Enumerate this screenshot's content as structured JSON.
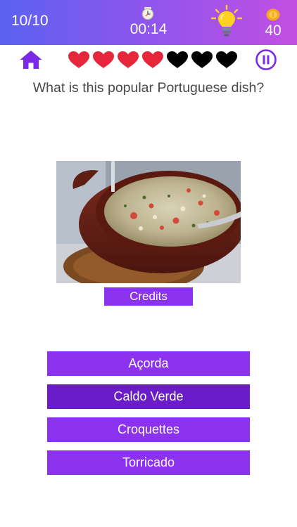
{
  "header": {
    "progress": "10/10",
    "timer": "00:14",
    "coins": "40",
    "icons": [
      "clock-icon",
      "lightbulb-icon",
      "coin-icon"
    ]
  },
  "status_bar": {
    "home_icon": "home-icon",
    "pause_icon": "pause-icon",
    "lives": {
      "total": 7,
      "remaining": 4,
      "full_color": "#e5263b",
      "empty_color": "#000000"
    }
  },
  "question": {
    "text": "What is this popular Portuguese dish?"
  },
  "image": {
    "subject": "clay pot of bread and seafood stew",
    "credits_label": "Credits"
  },
  "answers": [
    {
      "label": "Açorda",
      "selected": false
    },
    {
      "label": "Caldo Verde",
      "selected": true
    },
    {
      "label": "Croquettes",
      "selected": false
    },
    {
      "label": "Torricado",
      "selected": false
    }
  ],
  "colors": {
    "accent": "#8b32ee",
    "accent_selected": "#6a1cc8",
    "header_gradient": [
      "#5b62f0",
      "#c24fe2"
    ],
    "text": "#4a4a4a"
  }
}
